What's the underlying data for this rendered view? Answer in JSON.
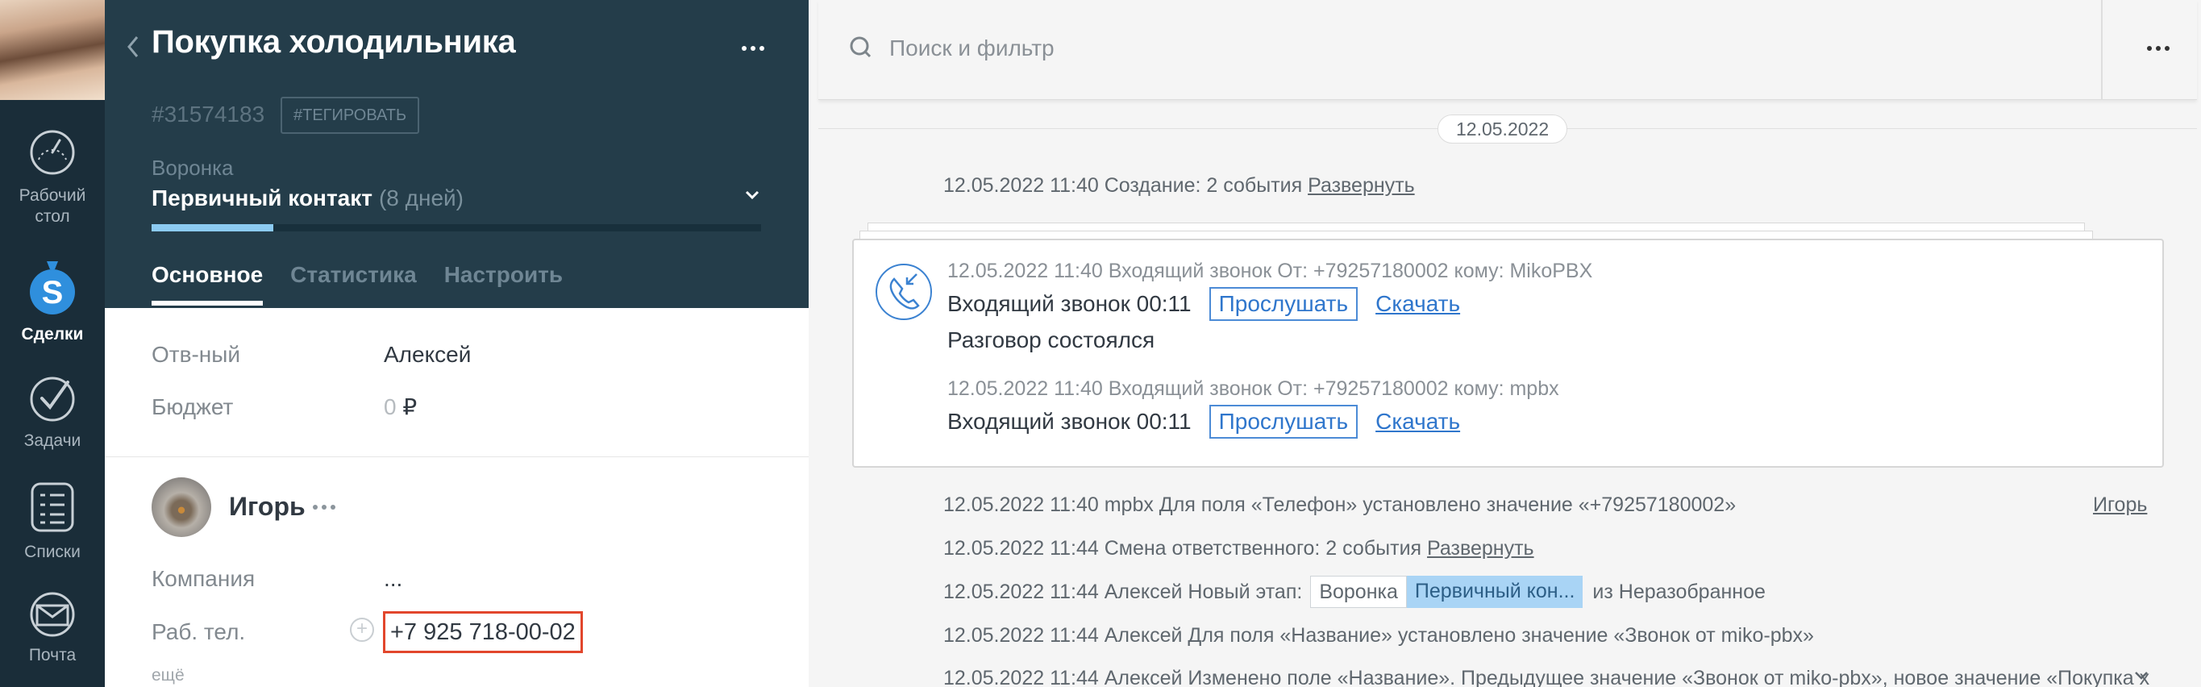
{
  "nav": {
    "items": [
      {
        "label_line1": "Рабочий",
        "label_line2": "стол",
        "icon": "speedometer-icon"
      },
      {
        "label_line1": "Сделки",
        "label_line2": "",
        "icon": "deals-money-icon"
      },
      {
        "label_line1": "Задачи",
        "label_line2": "",
        "icon": "tasks-check-icon"
      },
      {
        "label_line1": "Списки",
        "label_line2": "",
        "icon": "lists-icon"
      },
      {
        "label_line1": "Почта",
        "label_line2": "",
        "icon": "mail-icon"
      }
    ],
    "active_index": 1
  },
  "card": {
    "title": "Покупка холодильника",
    "deal_id": "#31574183",
    "tag_button": "#ТЕГИРОВАТЬ",
    "pipeline_label": "Воронка",
    "stage_name": "Первичный контакт",
    "stage_days": "(8 дней)",
    "stage_progress": 0.2,
    "tabs": [
      "Основное",
      "Статистика",
      "Настроить"
    ],
    "active_tab": 0,
    "fields": [
      {
        "label": "Отв-ный",
        "value": "Алексей"
      },
      {
        "label": "Бюджет",
        "value_zero": "0",
        "currency": "₽"
      }
    ],
    "contact": {
      "name": "Игорь",
      "company_label": "Компания",
      "company_value": "...",
      "phone_label": "Раб. тел.",
      "phone_value": "+7 925 718-00-02",
      "more_label": "ещё"
    }
  },
  "feed": {
    "search_placeholder": "Поиск и фильтр",
    "date_pill": "12.05.2022",
    "creation_note": "12.05.2022 11:40 Создание: 2 события",
    "expand_label": "Развернуть",
    "calls": [
      {
        "meta": "12.05.2022 11:40 Входящий звонок От: +79257180002 кому: MikoPBX",
        "title": "Входящий звонок 00:11",
        "listen": "Прослушать",
        "download": "Скачать",
        "result": "Разговор состоялся"
      },
      {
        "meta": "12.05.2022 11:40 Входящий звонок От: +79257180002 кому: mpbx",
        "title": "Входящий звонок 00:11",
        "listen": "Прослушать",
        "download": "Скачать"
      }
    ],
    "events": [
      {
        "text": "12.05.2022 11:40 mpbx Для поля «Телефон» установлено значение «+79257180002»",
        "right": "Игорь"
      },
      {
        "text": "12.05.2022 11:44 Смена ответственного: 2 события",
        "link": "Развернуть"
      },
      {
        "text": "12.05.2022 11:44 Алексей Новый этап:",
        "chip1": "Воронка",
        "chip2": "Первичный кон...",
        "tail": "из Неразобранное"
      },
      {
        "text": "12.05.2022 11:44 Алексей Для поля «Название» установлено значение «Звонок от miko-pbx»"
      },
      {
        "text": "12.05.2022 11:44 Алексей Изменено поле «Название». Предыдущее значение «Звонок от miko-pbx», новое значение «Покупка х"
      }
    ]
  }
}
